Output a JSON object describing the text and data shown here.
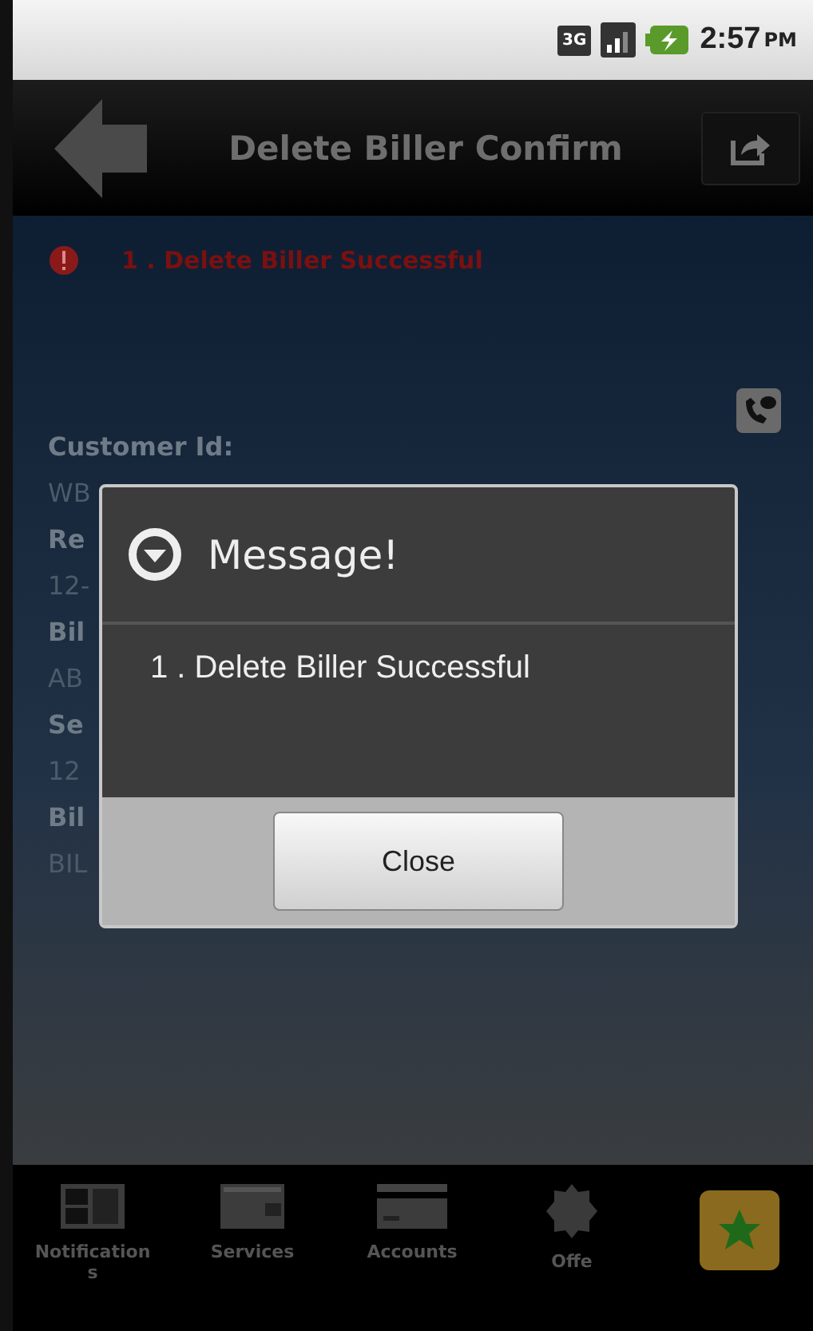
{
  "status_bar": {
    "network": "3G",
    "time": "2:57",
    "ampm": "PM"
  },
  "header": {
    "title": "Delete Biller Confirm"
  },
  "error": {
    "message": "1 . Delete Biller Successful"
  },
  "fields": [
    {
      "kind": "label",
      "text": "Customer Id:"
    },
    {
      "kind": "value",
      "text": "WB"
    },
    {
      "kind": "label",
      "text": "Re"
    },
    {
      "kind": "value",
      "text": "12-"
    },
    {
      "kind": "label",
      "text": "Bil"
    },
    {
      "kind": "value",
      "text": "AB"
    },
    {
      "kind": "label",
      "text": "Se"
    },
    {
      "kind": "value",
      "text": "12"
    },
    {
      "kind": "label",
      "text": "Bil"
    },
    {
      "kind": "value",
      "text": "BIL"
    }
  ],
  "dialog": {
    "title": "Message!",
    "message": "1 . Delete Biller Successful",
    "button": "Close"
  },
  "tabs": [
    {
      "label": "Notifications",
      "kind": "grid"
    },
    {
      "label": "Services",
      "kind": "wallet"
    },
    {
      "label": "Accounts",
      "kind": "card"
    },
    {
      "label": "Offe",
      "kind": "badge"
    }
  ]
}
